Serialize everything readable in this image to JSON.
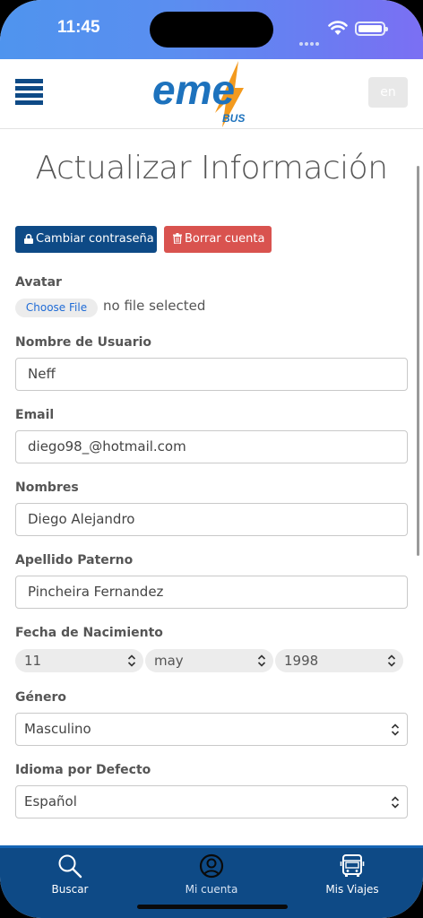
{
  "status": {
    "time": "11:45"
  },
  "header": {
    "logo_text": "eme",
    "logo_sub": "BUS",
    "lang": "en"
  },
  "page": {
    "title": "Actualizar Información"
  },
  "actions": {
    "change_password": "Cambiar contraseña",
    "delete_account": "Borrar cuenta"
  },
  "form": {
    "avatar": {
      "label": "Avatar",
      "button": "Choose File",
      "status": "no file selected"
    },
    "username": {
      "label": "Nombre de Usuario",
      "value": "Neff"
    },
    "email": {
      "label": "Email",
      "value": "diego98_@hotmail.com"
    },
    "names": {
      "label": "Nombres",
      "value": "Diego Alejandro"
    },
    "lastname": {
      "label": "Apellido Paterno",
      "value": "Pincheira Fernandez"
    },
    "birthdate": {
      "label": "Fecha de Nacimiento",
      "day": "11",
      "month": "may",
      "year": "1998"
    },
    "gender": {
      "label": "Género",
      "value": "Masculino"
    },
    "language": {
      "label": "Idioma por Defecto",
      "value": "Español"
    }
  },
  "tabbar": {
    "search": "Buscar",
    "account": "Mi cuenta",
    "trips": "Mis Viajes"
  },
  "colors": {
    "primary": "#0e4a86",
    "danger": "#d9534f",
    "accent": "#f39a1e"
  }
}
